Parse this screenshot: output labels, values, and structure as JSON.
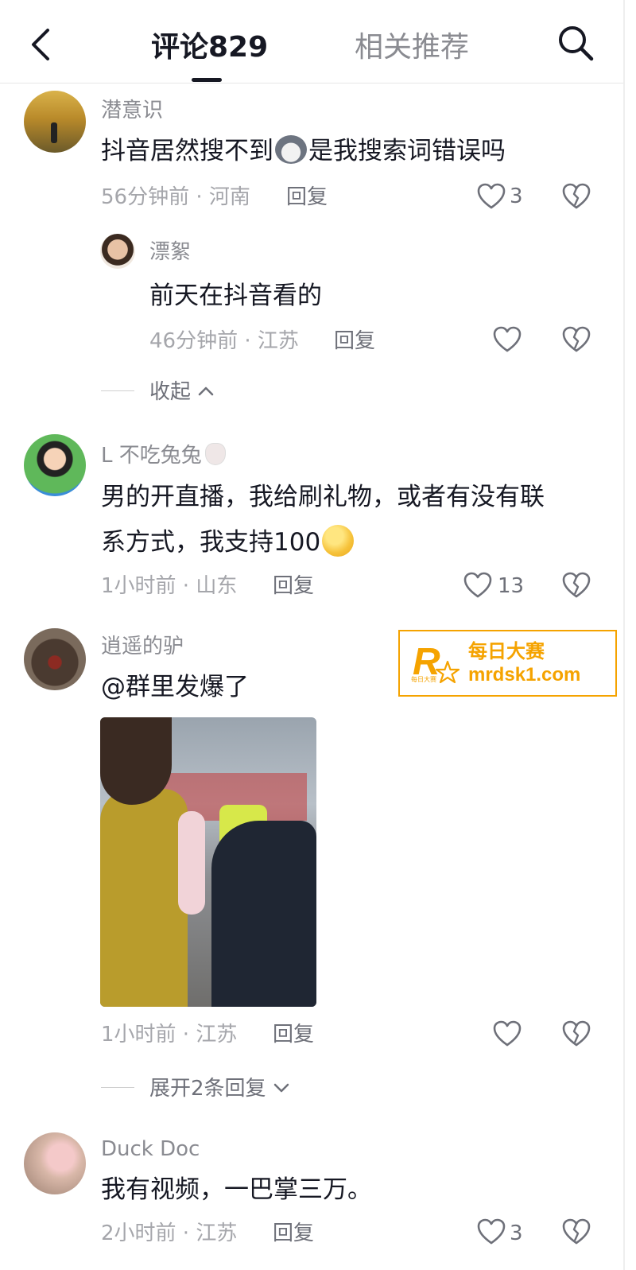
{
  "header": {
    "tab_comments": "评论829",
    "tab_related": "相关推荐"
  },
  "comments": [
    {
      "user": "潜意识",
      "text": "抖音居然搜不到",
      "text_after": "是我搜索词错误吗",
      "time_loc": "56分钟前 · 河南",
      "reply_label": "回复",
      "likes": "3",
      "replies": [
        {
          "user": "漂絮",
          "text": "前天在抖音看的",
          "time_loc": "46分钟前 · 江苏",
          "reply_label": "回复",
          "likes": ""
        }
      ],
      "fold_label": "收起"
    },
    {
      "user": "L   不吃兔兔",
      "text_line1": "男的开直播，我给刷礼物，或者有没有联",
      "text_line2": "系方式，我支持100",
      "time_loc": "1小时前 · 山东",
      "reply_label": "回复",
      "likes": "13"
    },
    {
      "user": "逍遥的驴",
      "text": "@群里发爆了",
      "time_loc": "1小时前 · 江苏",
      "reply_label": "回复",
      "likes": "",
      "expand_label": "展开2条回复"
    },
    {
      "user": "Duck Doc",
      "text": "我有视频，一巴掌三万。",
      "time_loc": "2小时前 · 江苏",
      "reply_label": "回复",
      "likes": "3"
    }
  ],
  "watermark": {
    "line1": "每日大赛",
    "line2": "mrdsk1.com",
    "tiny": "每日大赛"
  },
  "colors": {
    "text": "#161823",
    "secondary": "#8a8b91",
    "watermark": "#f5a300"
  }
}
